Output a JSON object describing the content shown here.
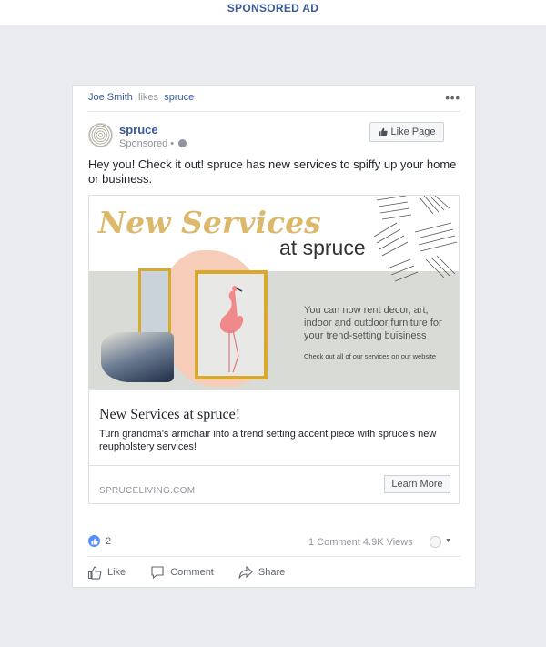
{
  "banner": {
    "label": "SPONSORED AD"
  },
  "post": {
    "activity": {
      "user": "Joe Smith",
      "verb": "likes",
      "page": "spruce"
    },
    "more_icon": "more-dots-icon",
    "page_name": "spruce",
    "sponsored_label": "Sponsored •",
    "like_page_label": "Like Page",
    "body_text": "Hey you! Check it out! spruce has new services to spiffy up your home or business."
  },
  "ad": {
    "image": {
      "headline": "New Services",
      "subhead": "at spruce",
      "copy": "You can now rent decor, art, indoor and outdoor furniture for your trend-setting buisiness",
      "note": "Check out all of our services on our website"
    },
    "title": "New Services at spruce!",
    "description": "Turn grandma’s armchair into a trend setting accent piece with spruce’s new reupholstery services!",
    "domain": "SPRUCELIVING.COM",
    "cta_label": "Learn More"
  },
  "engagement": {
    "like_count": "2",
    "stats": "1 Comment 4.9K Views"
  },
  "actions": [
    {
      "label": "Like",
      "icon": "thumbs-up-icon"
    },
    {
      "label": "Comment",
      "icon": "comment-icon"
    },
    {
      "label": "Share",
      "icon": "share-icon"
    }
  ],
  "colors": {
    "accent": "#365899",
    "brand_gold": "#dcb86a",
    "background": "#e9ebee"
  }
}
